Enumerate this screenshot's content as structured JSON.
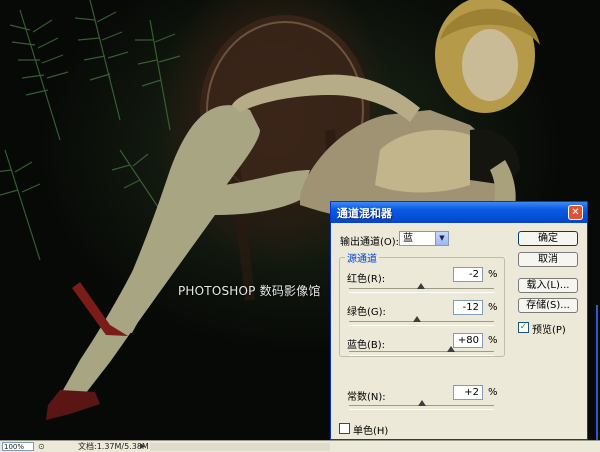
{
  "watermark": "PHOTOSHOP 数码影像馆",
  "status_bar": {
    "zoom": "100%",
    "doc_info": "文档:1.37M/5.38M"
  },
  "dialog": {
    "title": "通道混和器",
    "output_channel_label": "输出通道(O):",
    "output_channel_value": "蓝",
    "source_group_title": "源通道",
    "sliders": [
      {
        "label": "红色(R):",
        "value": "-2",
        "unit": "%",
        "level": -2
      },
      {
        "label": "绿色(G):",
        "value": "-12",
        "unit": "%",
        "level": -12
      },
      {
        "label": "蓝色(B):",
        "value": "+80",
        "unit": "%",
        "level": 80
      }
    ],
    "constant": {
      "label": "常数(N):",
      "value": "+2",
      "unit": "%",
      "level": 2
    },
    "buttons": {
      "ok": "确定",
      "cancel": "取消",
      "load": "载入(L)...",
      "save": "存储(S)..."
    },
    "preview_label": "预览(P)",
    "preview_checked": true,
    "monochrome_label": "单色(H)",
    "monochrome_checked": false,
    "close_glyph": "✕"
  },
  "icons": {
    "dropdown": "chevron-down-icon",
    "close": "close-icon",
    "check": "check-icon"
  },
  "colors": {
    "title_bar": "#0a5be3",
    "dialog_bg": "#ece9d8",
    "close_button": "#e0522f",
    "group_title": "#0046d5"
  }
}
